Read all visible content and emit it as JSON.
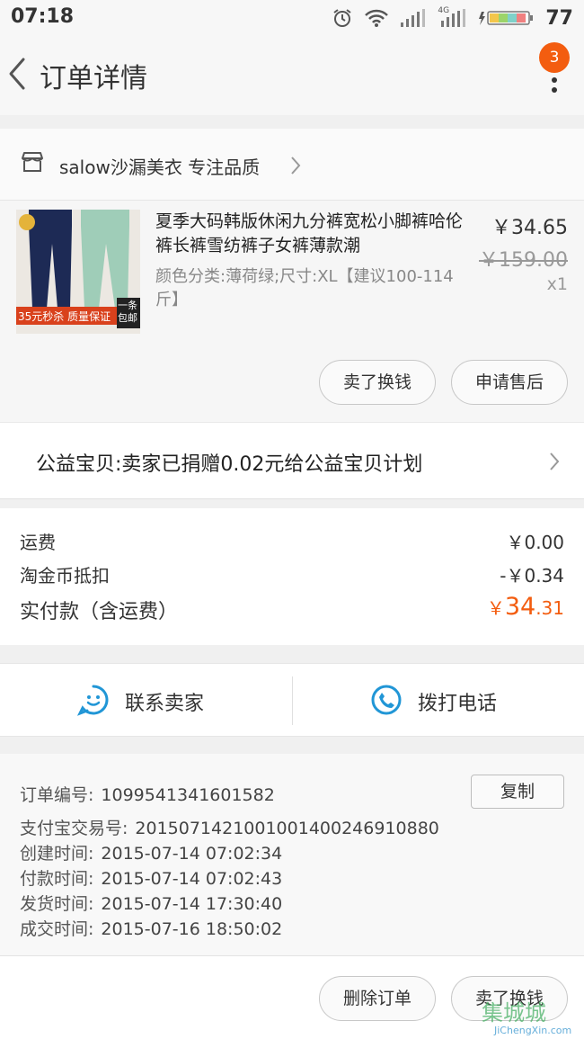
{
  "status_bar": {
    "time": "07:18",
    "battery": "77",
    "network": "4G"
  },
  "nav": {
    "title": "订单详情",
    "badge_count": "3"
  },
  "shop": {
    "name": "salow沙漏美衣 专注品质"
  },
  "item": {
    "title": "夏季大码韩版休闲九分裤宽松小脚裤哈伦裤长裤雪纺裤子女裤薄款潮",
    "sku": "颜色分类:薄荷绿;尺寸:XL【建议100-114斤】",
    "price": "￥34.65",
    "original_price": "￥159.00",
    "quantity": "x1",
    "thumbnail_banner": "35元秒杀 质量保证",
    "thumbnail_tag": "一条包邮",
    "buttons": {
      "sell": "卖了换钱",
      "after_sale": "申请售后"
    }
  },
  "charity": {
    "text": "公益宝贝:卖家已捐赠0.02元给公益宝贝计划"
  },
  "fees": {
    "shipping_label": "运费",
    "shipping_value": "￥0.00",
    "coin_label": "淘金币抵扣",
    "coin_value": "-￥0.34",
    "total_label": "实付款（含运费）",
    "total_symbol": "￥",
    "total_int": "34",
    "total_dec": ".31"
  },
  "contact": {
    "seller_label": "联系卖家",
    "call_label": "拨打电话"
  },
  "order_info": {
    "order_no_label": "订单编号:",
    "order_no": "1099541341601582",
    "copy_label": "复制",
    "alipay_label": "支付宝交易号:",
    "alipay_no": "2015071421001001400246910880",
    "created_label": "创建时间:",
    "created": "2015-07-14 07:02:34",
    "paid_label": "付款时间:",
    "paid": "2015-07-14 07:02:43",
    "shipped_label": "发货时间:",
    "shipped": "2015-07-14 17:30:40",
    "done_label": "成交时间:",
    "done": "2015-07-16 18:50:02"
  },
  "bottom_bar": {
    "delete_label": "删除订单",
    "sell_label": "卖了换钱"
  },
  "watermark": {
    "logo": "集城城",
    "url": "JiChengXin.com"
  },
  "colors": {
    "accent": "#f35d10",
    "contact_blue": "#2196d6"
  }
}
